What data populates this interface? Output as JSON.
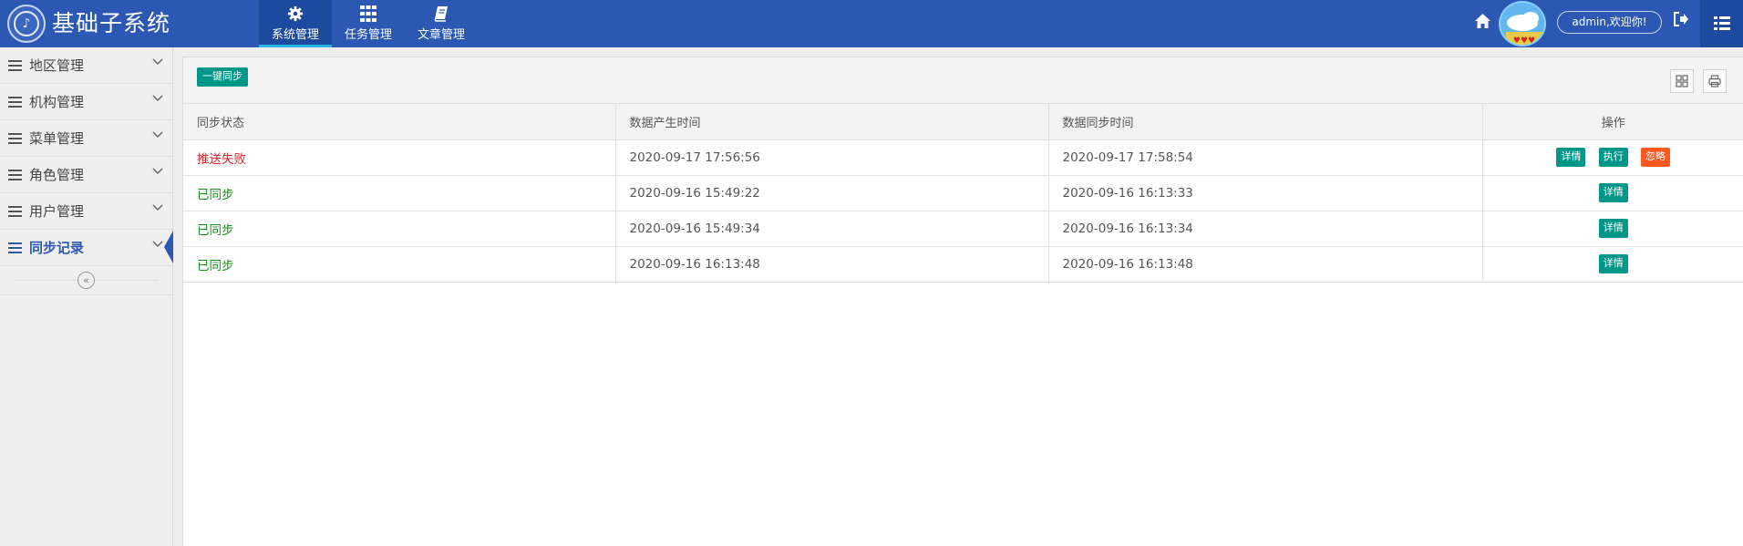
{
  "header": {
    "app_title": "基础子系统",
    "nav": [
      {
        "label": "系统管理",
        "icon": "gear-icon",
        "active": true
      },
      {
        "label": "任务管理",
        "icon": "grid-icon",
        "active": false
      },
      {
        "label": "文章管理",
        "icon": "book-icon",
        "active": false
      }
    ],
    "user_greeting": "admin,欢迎你!",
    "colors": {
      "bar": "#2c58b4",
      "active": "#1d4a9e",
      "accent_underline": "#27b5e8"
    }
  },
  "sidebar": {
    "items": [
      {
        "label": "地区管理",
        "active": false
      },
      {
        "label": "机构管理",
        "active": false
      },
      {
        "label": "菜单管理",
        "active": false
      },
      {
        "label": "角色管理",
        "active": false
      },
      {
        "label": "用户管理",
        "active": false
      },
      {
        "label": "同步记录",
        "active": true
      }
    ],
    "collapse_glyph": "«"
  },
  "toolbar": {
    "sync_all_label": "一键同步"
  },
  "table": {
    "columns": [
      "同步状态",
      "数据产生时间",
      "数据同步时间",
      "操作"
    ],
    "rows": [
      {
        "status": "推送失败",
        "status_type": "fail",
        "created": "2020-09-17 17:56:56",
        "synced": "2020-09-17 17:58:54",
        "actions": [
          "详情",
          "执行",
          "忽略"
        ]
      },
      {
        "status": "已同步",
        "status_type": "ok",
        "created": "2020-09-16 15:49:22",
        "synced": "2020-09-16 16:13:33",
        "actions": [
          "详情"
        ]
      },
      {
        "status": "已同步",
        "status_type": "ok",
        "created": "2020-09-16 15:49:34",
        "synced": "2020-09-16 16:13:34",
        "actions": [
          "详情"
        ]
      },
      {
        "status": "已同步",
        "status_type": "ok",
        "created": "2020-09-16 16:13:48",
        "synced": "2020-09-16 16:13:48",
        "actions": [
          "详情"
        ]
      }
    ]
  },
  "colors": {
    "primary_button": "#009688",
    "danger_button": "#ff5722",
    "fail_text": "#e0242c",
    "ok_text": "#1a8f1a"
  }
}
